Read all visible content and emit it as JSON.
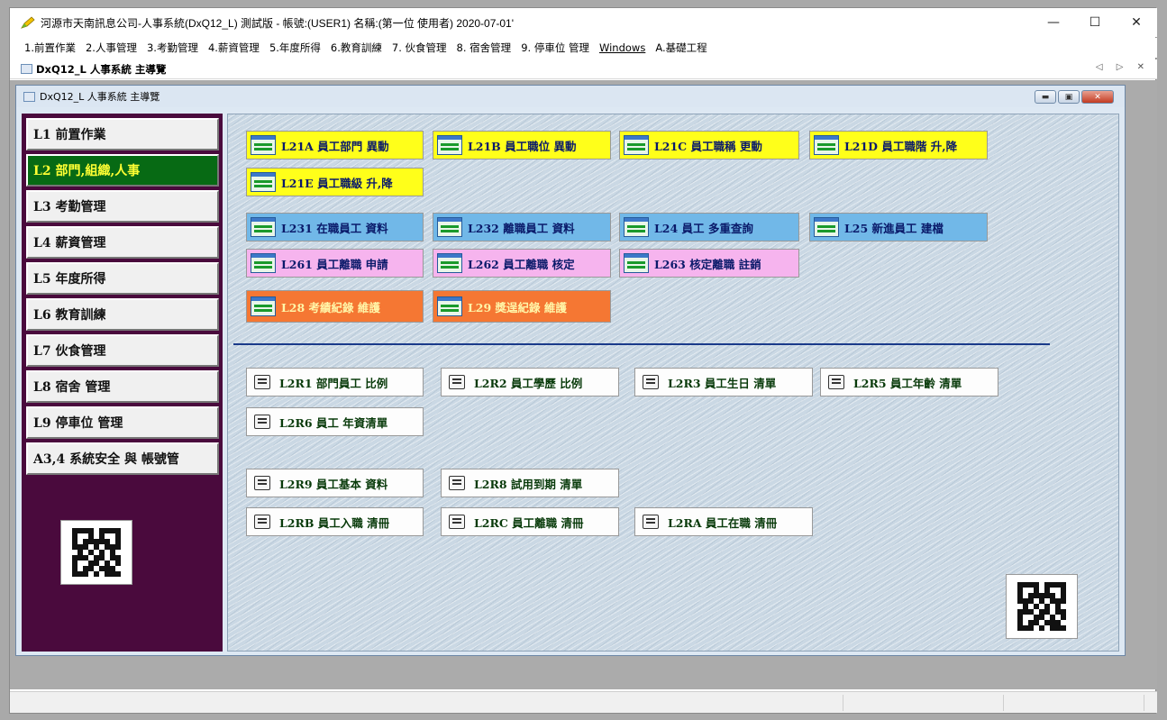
{
  "window": {
    "title": "河源市天南訊息公司-人事系統(DxQ12_L) 測試版 - 帳號:(USER1) 名稱:(第一位 使用者) 2020-07-01'",
    "minimize_glyph": "—",
    "maximize_glyph": "☐",
    "close_glyph": "✕"
  },
  "menu": [
    "1.前置作業",
    "2.人事管理",
    "3.考勤管理",
    "4.薪資管理",
    "5.年度所得",
    "6.教育訓練",
    "7. 伙食管理",
    "8. 宿舍管理",
    "9. 停車位 管理",
    "Windows",
    "A.基礎工程"
  ],
  "tab": {
    "label": "DxQ12_L 人事系統 主導覽",
    "nav": "◁ ▷ ✕"
  },
  "child_window": {
    "title": "DxQ12_L 人事系統 主導覽",
    "min_glyph": "▬",
    "max_glyph": "▣",
    "close_glyph": "✕"
  },
  "sidebar": {
    "items": [
      {
        "label": "L1 前置作業",
        "active": false
      },
      {
        "label": "L2 部門,組織,人事",
        "active": true
      },
      {
        "label": "L3 考勤管理",
        "active": false
      },
      {
        "label": "L4 薪資管理",
        "active": false
      },
      {
        "label": "L5 年度所得",
        "active": false
      },
      {
        "label": "L6 教育訓練",
        "active": false
      },
      {
        "label": "L7 伙食管理",
        "active": false
      },
      {
        "label": "L8 宿舍 管理",
        "active": false
      },
      {
        "label": "L9 停車位 管理",
        "active": false
      },
      {
        "label": "A3,4 系統安全 與 帳號管",
        "active": false
      }
    ]
  },
  "form_buttons": {
    "yellow": [
      "L21A 員工部門 異動",
      "L21B 員工職位 異動",
      "L21C 員工職稱 更動",
      "L21D 員工職階 升,降",
      "L21E 員工職級 升,降"
    ],
    "blue": [
      "L231 在職員工 資料",
      "L232 離職員工 資料",
      "L24  員工 多重查詢",
      "L25  新進員工 建檔"
    ],
    "pink": [
      "L261 員工離職 申請",
      "L262 員工離職 核定",
      "L263 核定離職 註銷"
    ],
    "orange": [
      "L28 考績紀錄 維護",
      "L29 獎逞紀錄 維護"
    ]
  },
  "report_buttons": {
    "group1": [
      "L2R1 部門員工 比例",
      "L2R2 員工學歷 比例",
      "L2R3 員工生日 清單",
      "L2R5 員工年齡 清單",
      "L2R6 員工 年資清單"
    ],
    "group2": [
      "L2R9 員工基本 資料",
      "L2R8 試用到期 清單",
      "L2RB 員工入職 清冊",
      "L2RC 員工離職 清冊",
      "L2RA 員工在職 清冊"
    ]
  },
  "colors": {
    "sidebar_bg": "#4a0a3d",
    "active_item": "#076a14",
    "yellow_button": "#ffff1a",
    "blue_button": "#71b8e8",
    "pink_button": "#f6b4ee",
    "orange_button": "#f57733",
    "divider": "#1a3a8a"
  },
  "icons": {
    "app": "pencil-icon",
    "form_button": "form-icon",
    "report_button": "printer-icon",
    "qr": "qr-code-icon"
  }
}
